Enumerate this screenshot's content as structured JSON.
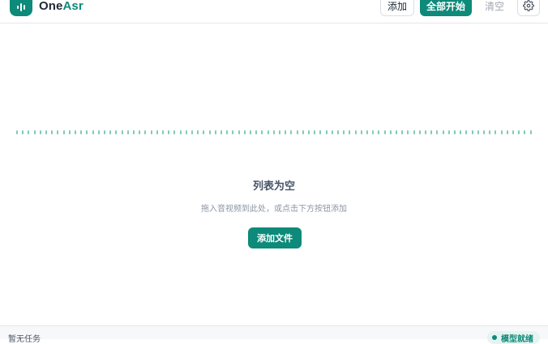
{
  "header": {
    "brand_one": "One",
    "brand_asr": "Asr",
    "logo_icon": "waveform-icon",
    "add_label": "添加",
    "start_all_label": "全部开始",
    "clear_label": "清空",
    "settings_icon": "gear-icon"
  },
  "main": {
    "wave_icon": "waveform-dotted-line",
    "empty_title": "列表为空",
    "empty_desc": "拖入音视频到此处，或点击下方按钮添加",
    "add_files_label": "添加文件"
  },
  "footer": {
    "status_text": "暂无任务",
    "model_status": "模型就绪"
  },
  "colors": {
    "accent": "#0d8a79",
    "wave": "#7ccbb8"
  }
}
